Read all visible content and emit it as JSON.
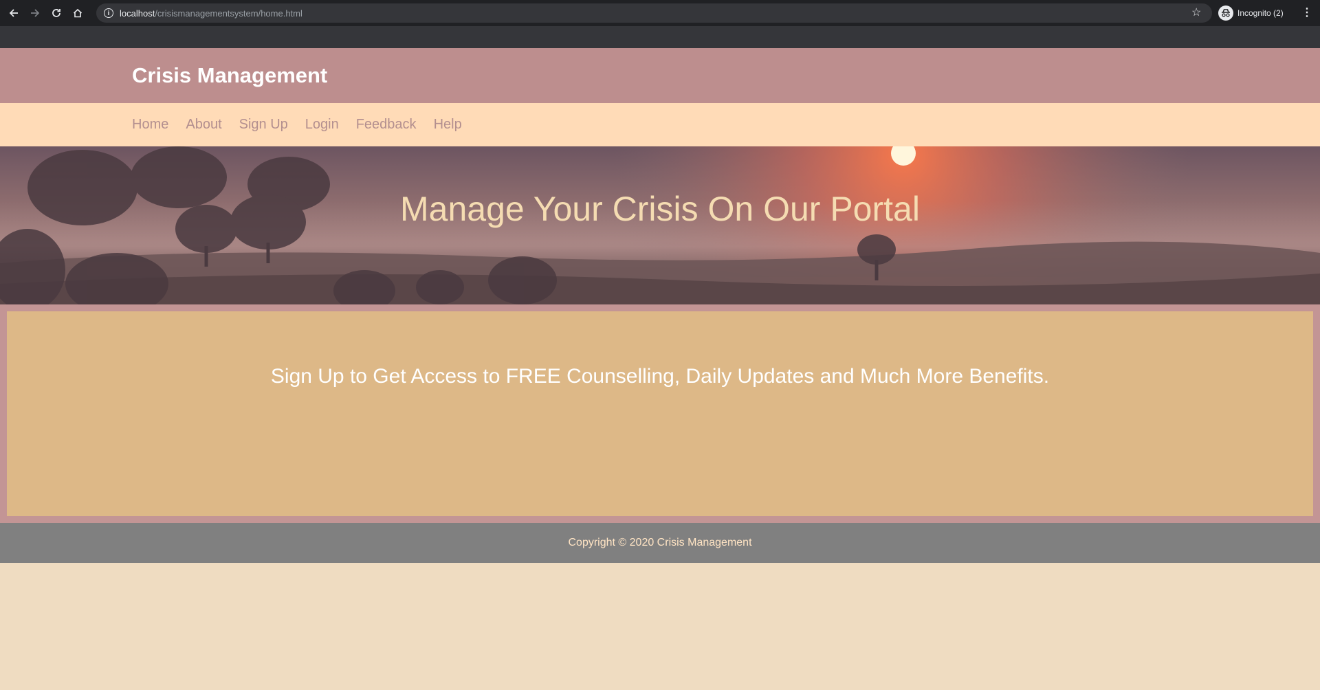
{
  "browser": {
    "url_host": "localhost",
    "url_path": "/crisismanagementsystem/home.html",
    "profile_label": "Incognito (2)"
  },
  "site": {
    "title": "Crisis Management",
    "nav": [
      {
        "label": "Home"
      },
      {
        "label": "About"
      },
      {
        "label": "Sign Up"
      },
      {
        "label": "Login"
      },
      {
        "label": "Feedback"
      },
      {
        "label": "Help"
      }
    ],
    "hero_title": "Manage Your Crisis On Our Portal",
    "cta_text": "Sign Up to Get Access to FREE Counselling, Daily Updates and Much More Benefits.",
    "footer_text": "Copyright © 2020 Crisis Management"
  },
  "colors": {
    "header_bg": "#bd8e8e",
    "nav_bg": "#ffdbb7",
    "content_bg": "#ddb887",
    "footer_bg": "#808080",
    "page_bg": "#efdcc1"
  }
}
